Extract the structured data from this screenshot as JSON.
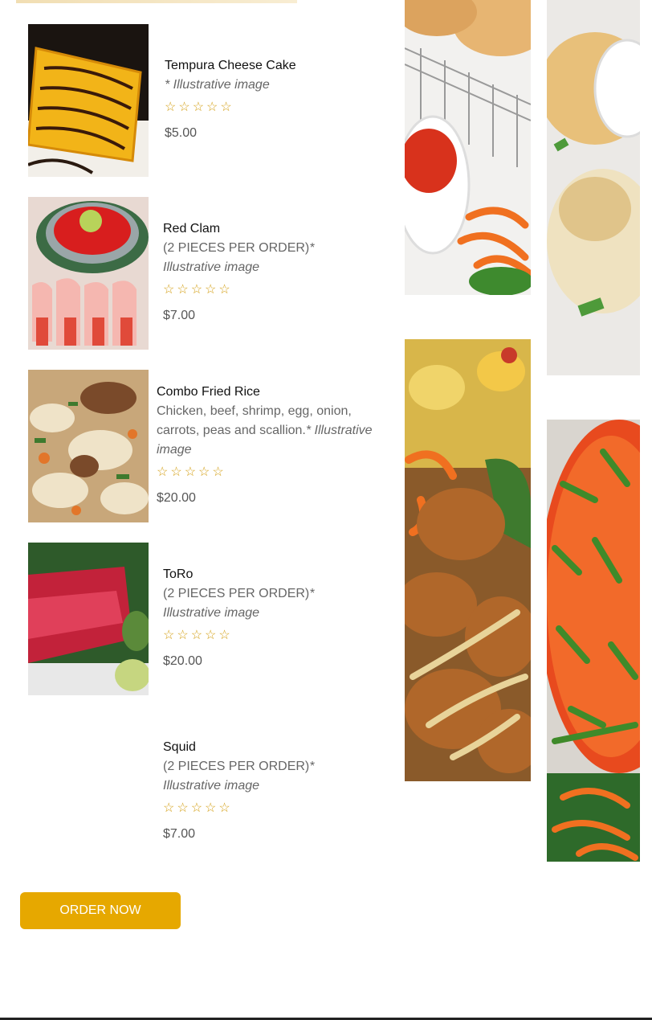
{
  "menu": {
    "items": [
      {
        "name": "Tempura Cheese Cake",
        "desc": "",
        "note": "* Illustrative image",
        "stars": "☆☆☆☆☆",
        "price": "$5.00"
      },
      {
        "name": "Red Clam",
        "desc": "(2 PIECES PER ORDER)",
        "note": "* Illustrative image",
        "stars": "☆☆☆☆☆",
        "price": "$7.00"
      },
      {
        "name": "Combo Fried Rice",
        "desc": "Chicken, beef, shrimp, egg, onion, carrots, peas and scallion.",
        "note": "* Illustrative image",
        "stars": "☆☆☆☆☆",
        "price": "$20.00"
      },
      {
        "name": "ToRo",
        "desc": "(2 PIECES PER ORDER)",
        "note": "* Illustrative image",
        "stars": "☆☆☆☆☆",
        "price": "$20.00"
      },
      {
        "name": "Squid",
        "desc": "(2 PIECES PER ORDER)",
        "note": "* Illustrative image",
        "stars": "☆☆☆☆☆",
        "price": "$7.00"
      }
    ]
  },
  "cta": {
    "order_label": "ORDER NOW"
  },
  "colors": {
    "accent": "#e6a800",
    "star": "#d4a017"
  }
}
